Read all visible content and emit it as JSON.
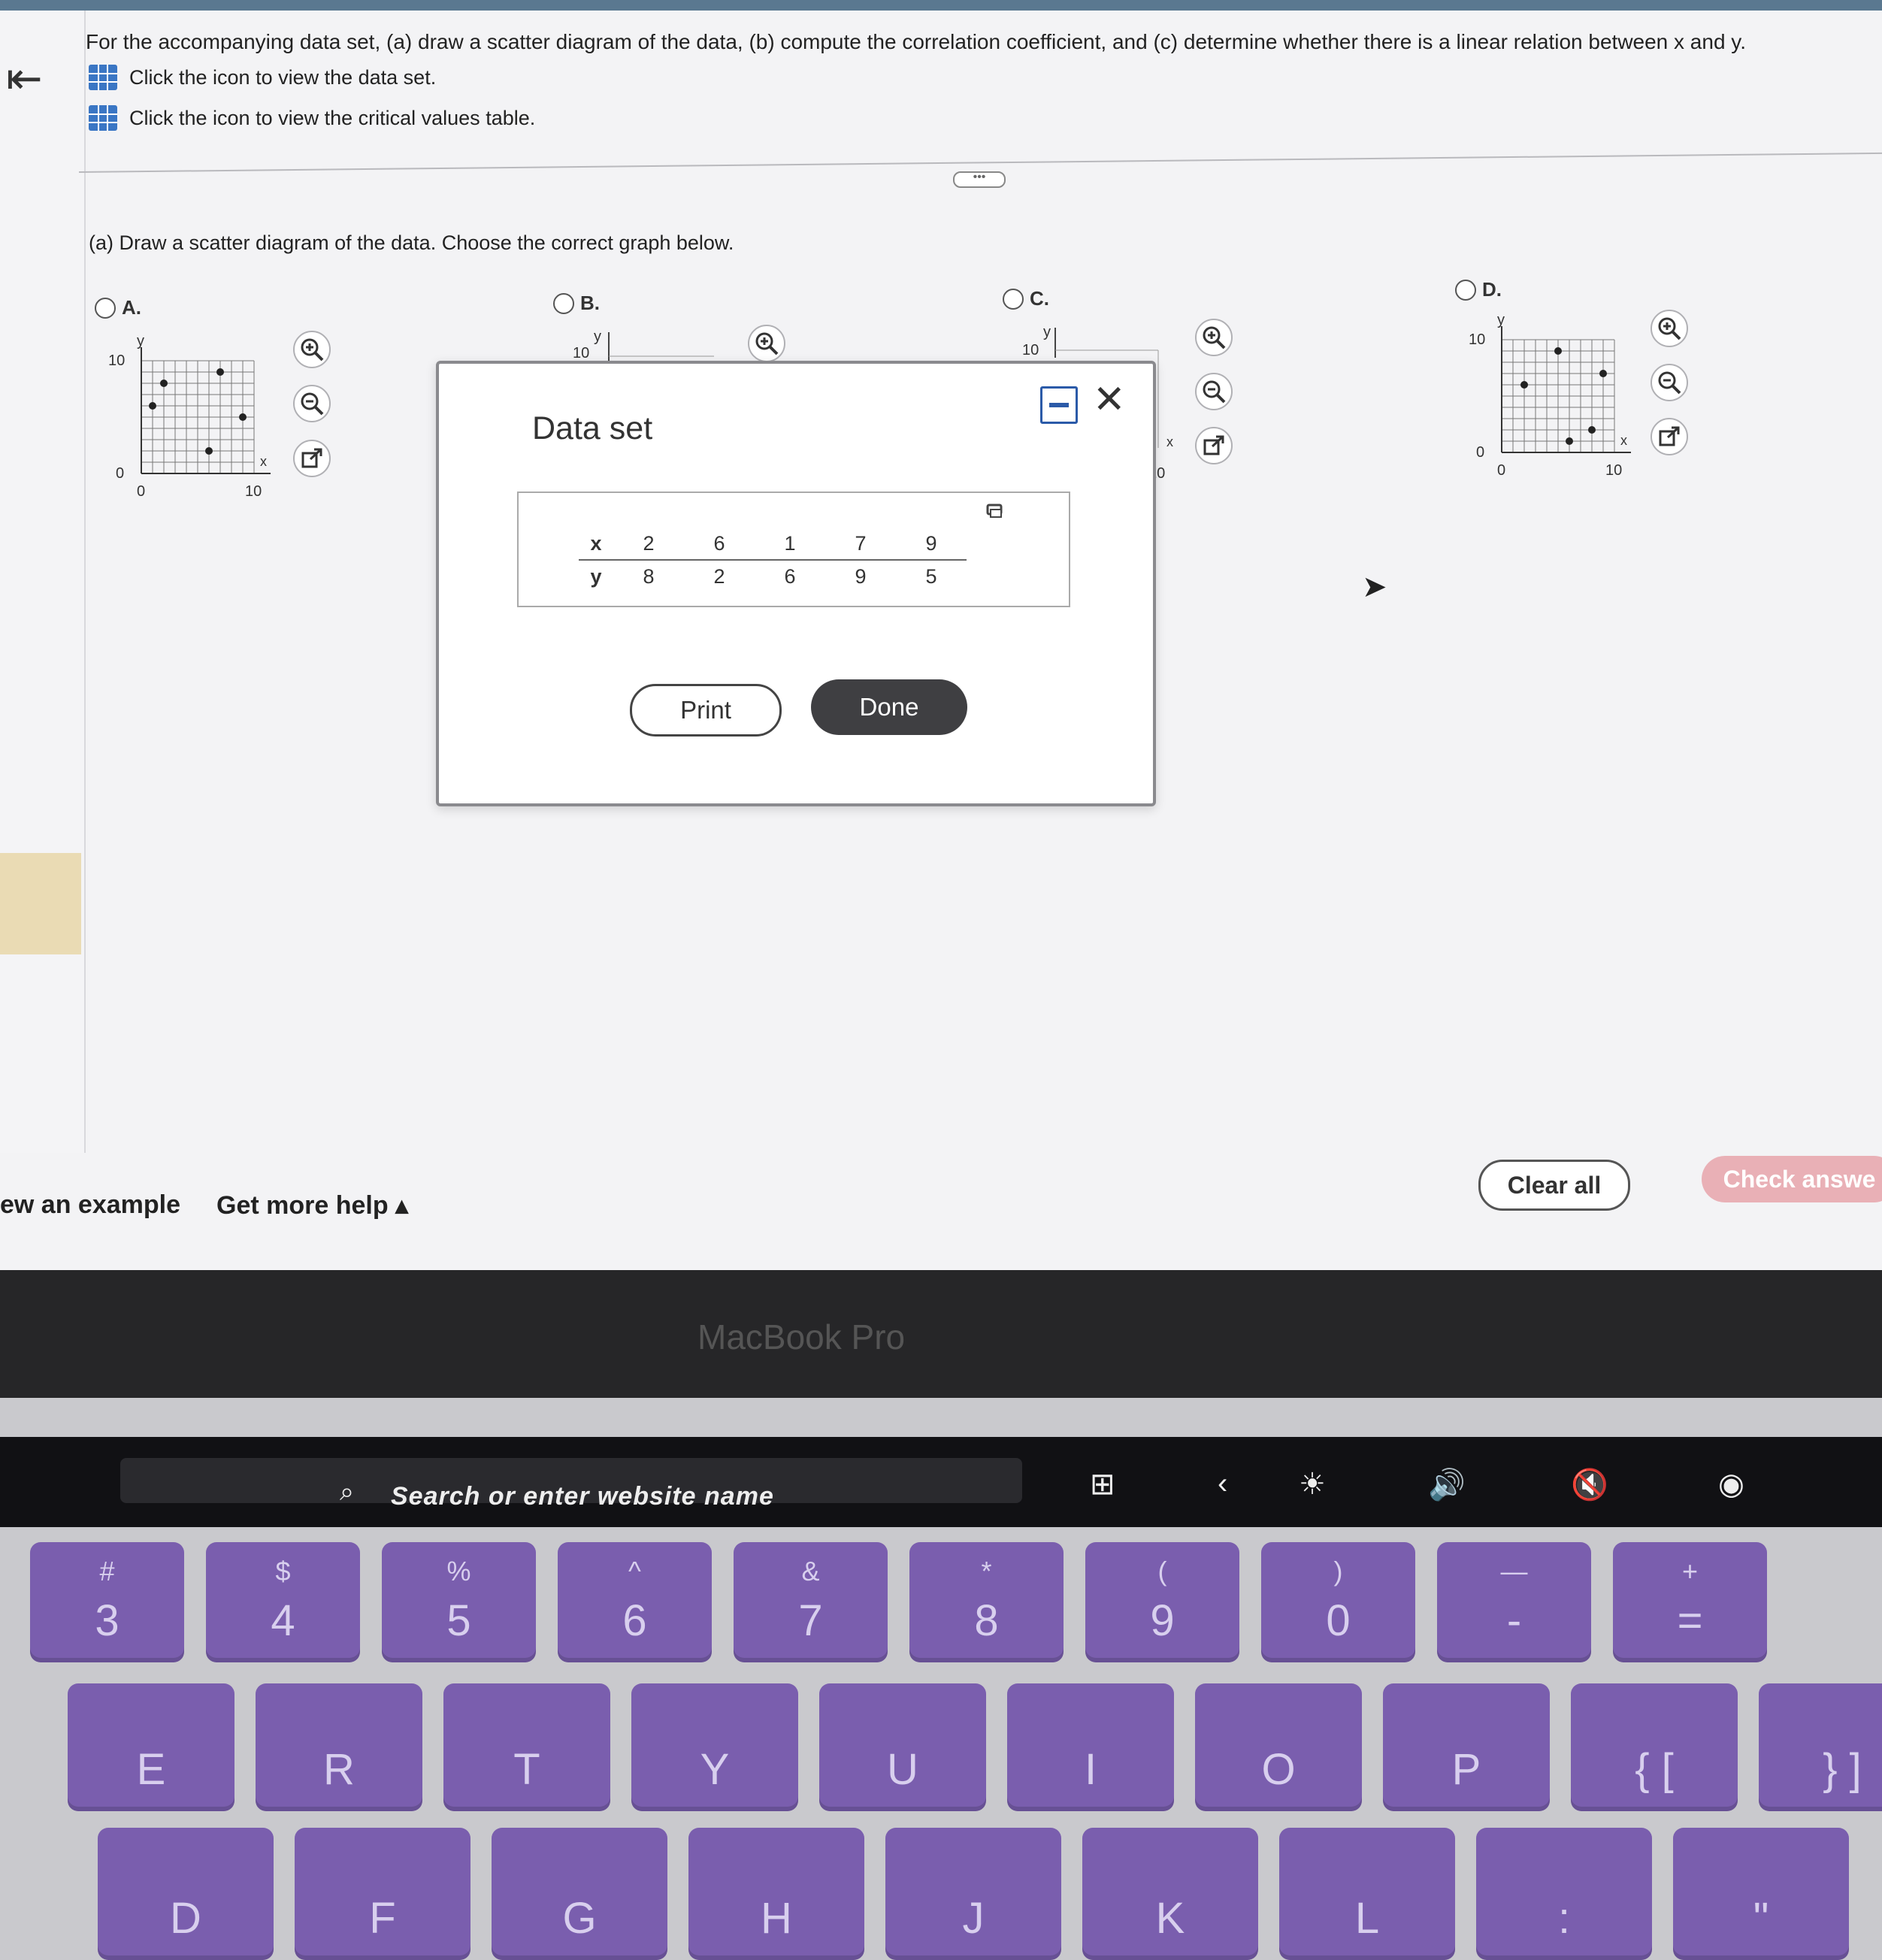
{
  "question": {
    "text": "For the accompanying data set, (a) draw a scatter diagram of the data, (b) compute the correlation coefficient, and (c) determine whether there is a linear relation between x and y.",
    "data_set_link": "Click the icon to view the data set.",
    "critical_values_link": "Click the icon to view the critical values table."
  },
  "part_a": "(a) Draw a scatter diagram of the data. Choose the correct graph below.",
  "options": {
    "a": {
      "label": "A."
    },
    "b": {
      "label": "B."
    },
    "c": {
      "label": "C."
    },
    "d": {
      "label": "D."
    }
  },
  "graph_labels": {
    "y_axis": "y",
    "x_axis": "x",
    "y_top": "10",
    "origin": "0",
    "x_tick_0": "0",
    "x_tick_10": "10"
  },
  "dialog": {
    "title": "Data set",
    "table": {
      "x_label": "x",
      "y_label": "y",
      "x": [
        "2",
        "6",
        "1",
        "7",
        "9"
      ],
      "y": [
        "8",
        "2",
        "6",
        "9",
        "5"
      ]
    },
    "print_label": "Print",
    "done_label": "Done"
  },
  "footer": {
    "example_link": "ew an example",
    "help_link": "Get more help ▴",
    "clear_all": "Clear all",
    "check_answer": "Check answe"
  },
  "laptop": {
    "brand": "MacBook Pro",
    "touchbar_search": "Search or enter website name"
  },
  "keys_row1": [
    {
      "top": "#",
      "main": "3"
    },
    {
      "top": "$",
      "main": "4"
    },
    {
      "top": "%",
      "main": "5"
    },
    {
      "top": "^",
      "main": "6"
    },
    {
      "top": "&",
      "main": "7"
    },
    {
      "top": "*",
      "main": "8"
    },
    {
      "top": "(",
      "main": "9"
    },
    {
      "top": ")",
      "main": "0"
    },
    {
      "top": "—",
      "main": "-"
    },
    {
      "top": "+",
      "main": "="
    }
  ],
  "keys_row2": [
    "E",
    "R",
    "T",
    "Y",
    "U",
    "I",
    "O",
    "P",
    "{ [",
    "} ]"
  ],
  "keys_row3": [
    "D",
    "F",
    "G",
    "H",
    "J",
    "K",
    "L",
    ":",
    "\""
  ],
  "colors": {
    "accent": "#3a76c4",
    "key": "#7a5eae",
    "done_button": "#3f3f42",
    "check_button": "#e9b0b6"
  }
}
